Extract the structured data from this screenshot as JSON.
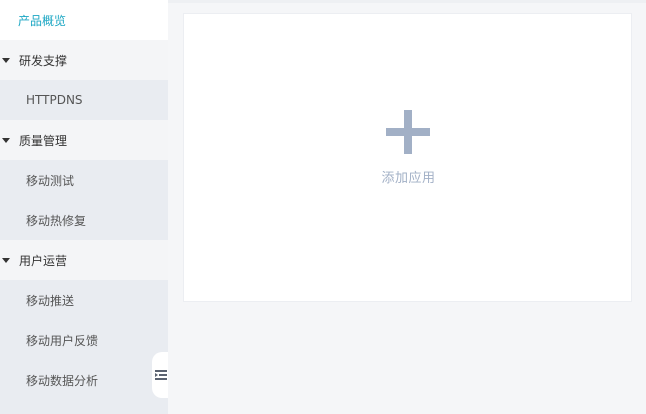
{
  "sidebar": {
    "items": [
      {
        "label": "产品概览",
        "type": "active"
      },
      {
        "label": "研发支撑",
        "type": "group"
      },
      {
        "label": "HTTPDNS",
        "type": "child"
      },
      {
        "label": "质量管理",
        "type": "group"
      },
      {
        "label": "移动测试",
        "type": "child"
      },
      {
        "label": "移动热修复",
        "type": "child"
      },
      {
        "label": "用户运营",
        "type": "group"
      },
      {
        "label": "移动推送",
        "type": "child"
      },
      {
        "label": "移动用户反馈",
        "type": "child"
      },
      {
        "label": "移动数据分析",
        "type": "child"
      }
    ],
    "collapse_icon": "menu-collapse-icon"
  },
  "main": {
    "add_app": {
      "icon": "plus-icon",
      "label": "添加应用"
    }
  },
  "colors": {
    "accent": "#1aa6c3",
    "plus": "#a2b0c6",
    "sidebar_bg": "#e9ecf1"
  }
}
